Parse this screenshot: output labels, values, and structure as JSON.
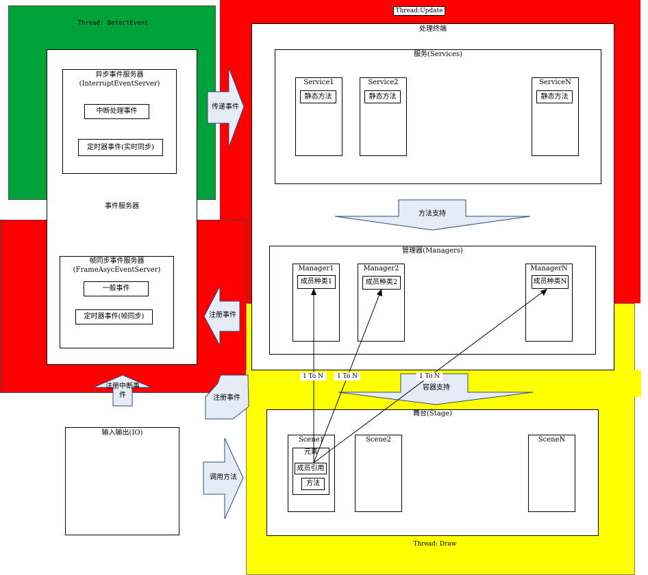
{
  "threads": {
    "detect": "Thread: DetectEvent",
    "update": "Thread:Update",
    "draw": "Thread: Draw"
  },
  "event_server": {
    "title": "事件服务器",
    "async": {
      "title": "异步事件服务器",
      "subtitle": "(InterruptEventServer)",
      "item1": "中断处理事件",
      "item2": "定时器事件(实时同步)"
    },
    "frame": {
      "title": "帧同步事件服务器",
      "subtitle": "(FrameAsycEventServer)",
      "item1": "一般事件",
      "item2": "定时器事件(帧同步)"
    }
  },
  "processing": {
    "title": "处理终端",
    "services": {
      "title": "服务(Services)",
      "items": [
        {
          "name": "Service1",
          "method": "静态方法"
        },
        {
          "name": "Service2",
          "method": "静态方法"
        },
        {
          "name": "ServiceN",
          "method": "静态方法"
        }
      ]
    },
    "managers": {
      "title": "管理器(Managers)",
      "items": [
        {
          "name": "Manager1",
          "member": "成员种类1"
        },
        {
          "name": "Manager2",
          "member": "成员种类2"
        },
        {
          "name": "ManagerN",
          "member": "成员种类N"
        }
      ]
    }
  },
  "stage": {
    "title": "舞台(Stage)",
    "scenes": [
      "Scene1",
      "Scene2",
      "SceneN"
    ],
    "element": {
      "title": "元素",
      "ref": "成员引用",
      "method": "方法"
    }
  },
  "io": {
    "title": "输入输出(IO)"
  },
  "arrows": {
    "pass_event": "传递事件",
    "method_support": "方法支持",
    "register_event_1": "注册事件",
    "register_interrupt": "注册中断事件",
    "register_event_2": "注册事件",
    "container_support": "容器支持",
    "call_method": "调用方法"
  },
  "connectors": {
    "one_to_n": "1 To N"
  },
  "colors": {
    "green": "#00a33a",
    "red": "#ff0000",
    "yellow": "#ffff00",
    "arrow_fill": "#e6ecf6"
  }
}
